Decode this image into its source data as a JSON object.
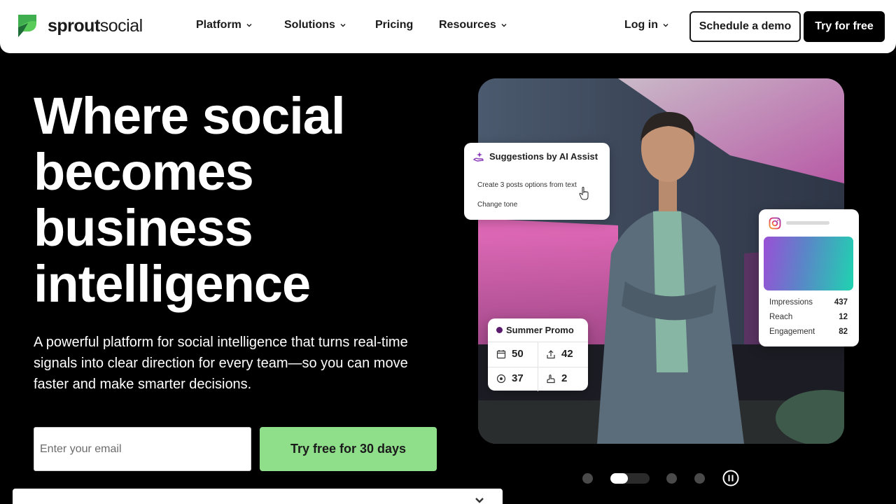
{
  "nav": {
    "logo_bold": "sprout",
    "logo_light": "social",
    "items": [
      {
        "label": "Platform",
        "has_dropdown": true
      },
      {
        "label": "Solutions",
        "has_dropdown": true
      },
      {
        "label": "Pricing",
        "has_dropdown": false
      },
      {
        "label": "Resources",
        "has_dropdown": true
      }
    ],
    "login": "Log in",
    "demo": "Schedule a demo",
    "try": "Try for free"
  },
  "hero": {
    "headline": [
      "Where social",
      "becomes",
      "business",
      "intelligence"
    ],
    "subtext": "A powerful platform for social intelligence that turns real-time signals into clear direction for every team—so you can move faster and make smarter decisions.",
    "email_placeholder": "Enter your email",
    "cta": "Try free for 30 days"
  },
  "ai_card": {
    "title": "Suggestions by AI Assist",
    "options": [
      "Create 3 posts options from text",
      "Change tone"
    ]
  },
  "promo_card": {
    "title": "Summer Promo",
    "stats": [
      {
        "icon": "calendar-icon",
        "value": "50"
      },
      {
        "icon": "share-icon",
        "value": "42"
      },
      {
        "icon": "eye-icon",
        "value": "37"
      },
      {
        "icon": "hand-icon",
        "value": "2"
      }
    ]
  },
  "ig_card": {
    "rows": [
      {
        "label": "Impressions",
        "value": "437"
      },
      {
        "label": "Reach",
        "value": "12"
      },
      {
        "label": "Engagement",
        "value": "82"
      }
    ]
  },
  "carousel": {
    "slides": 5,
    "active_index": 1,
    "progress": 0.45
  },
  "colors": {
    "accent": "#8fdf8a",
    "brand_green": "#59cb59",
    "promo_dot": "#5a1a6e"
  }
}
